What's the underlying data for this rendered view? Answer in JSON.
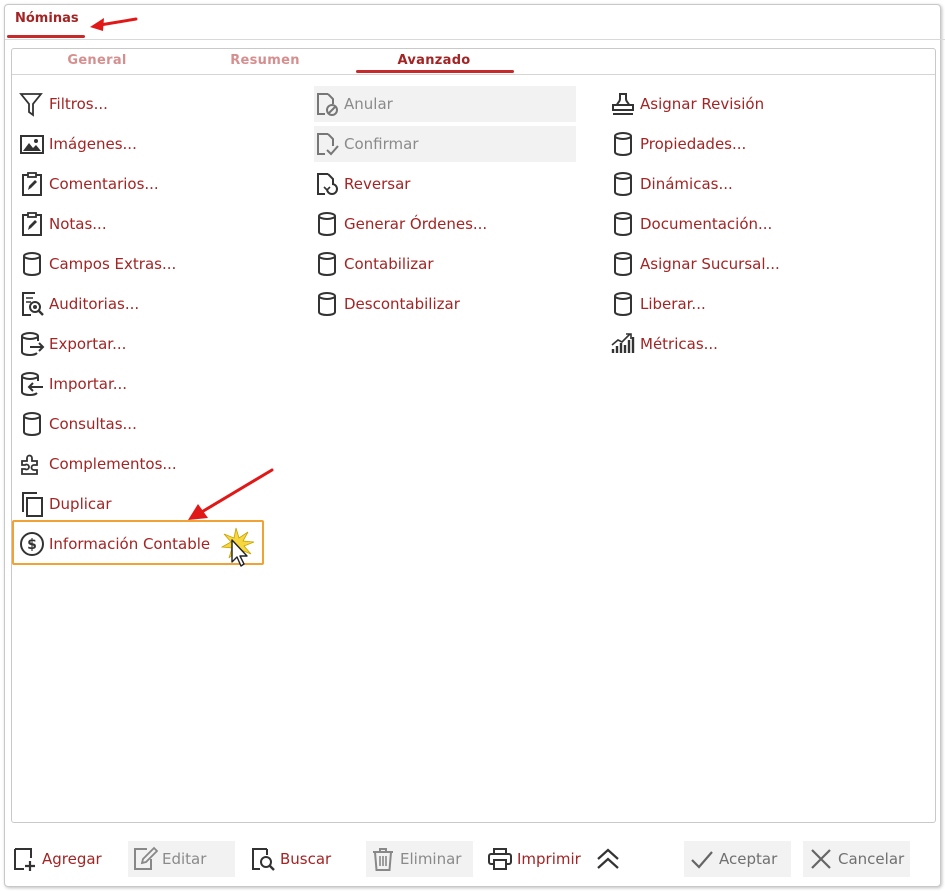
{
  "window": {
    "title": "Nóminas"
  },
  "tabs": [
    {
      "label": "General",
      "active": false
    },
    {
      "label": "Resumen",
      "active": false
    },
    {
      "label": "Avanzado",
      "active": true
    }
  ],
  "columns": {
    "left": [
      {
        "label": "Filtros...",
        "icon": "filter-icon"
      },
      {
        "label": "Imágenes...",
        "icon": "image-icon"
      },
      {
        "label": "Comentarios...",
        "icon": "clipboard-edit-icon"
      },
      {
        "label": "Notas...",
        "icon": "clipboard-edit-icon"
      },
      {
        "label": "Campos Extras...",
        "icon": "database-icon"
      },
      {
        "label": "Auditorias...",
        "icon": "document-search-icon"
      },
      {
        "label": "Exportar...",
        "icon": "database-export-icon"
      },
      {
        "label": "Importar...",
        "icon": "database-import-icon"
      },
      {
        "label": "Consultas...",
        "icon": "database-icon"
      },
      {
        "label": "Complementos...",
        "icon": "puzzle-icon"
      },
      {
        "label": "Duplicar",
        "icon": "copy-icon"
      },
      {
        "label": "Información Contable",
        "icon": "dollar-circle-icon"
      }
    ],
    "middle": [
      {
        "label": "Anular",
        "icon": "document-cancel-icon",
        "disabled": true
      },
      {
        "label": "Confirmar",
        "icon": "document-check-icon",
        "disabled": true
      },
      {
        "label": "Reversar",
        "icon": "document-revert-icon",
        "disabled": false
      },
      {
        "label": "Generar Órdenes...",
        "icon": "database-icon",
        "disabled": false
      },
      {
        "label": "Contabilizar",
        "icon": "database-icon",
        "disabled": false
      },
      {
        "label": "Descontabilizar",
        "icon": "database-icon",
        "disabled": false
      }
    ],
    "right": [
      {
        "label": "Asignar Revisión",
        "icon": "stamp-icon"
      },
      {
        "label": "Propiedades...",
        "icon": "database-icon"
      },
      {
        "label": "Dinámicas...",
        "icon": "database-icon"
      },
      {
        "label": "Documentación...",
        "icon": "database-icon"
      },
      {
        "label": "Asignar Sucursal...",
        "icon": "database-icon"
      },
      {
        "label": "Liberar...",
        "icon": "database-icon"
      },
      {
        "label": "Métricas...",
        "icon": "chart-bars-icon"
      }
    ]
  },
  "toolbar": {
    "add": "Agregar",
    "edit": "Editar",
    "search": "Buscar",
    "delete": "Eliminar",
    "print": "Imprimir",
    "accept": "Aceptar",
    "cancel": "Cancelar"
  },
  "colors": {
    "accent": "#a32424",
    "underline": "#c72a2a",
    "highlight": "#f0a235",
    "arrow": "#e01818"
  }
}
